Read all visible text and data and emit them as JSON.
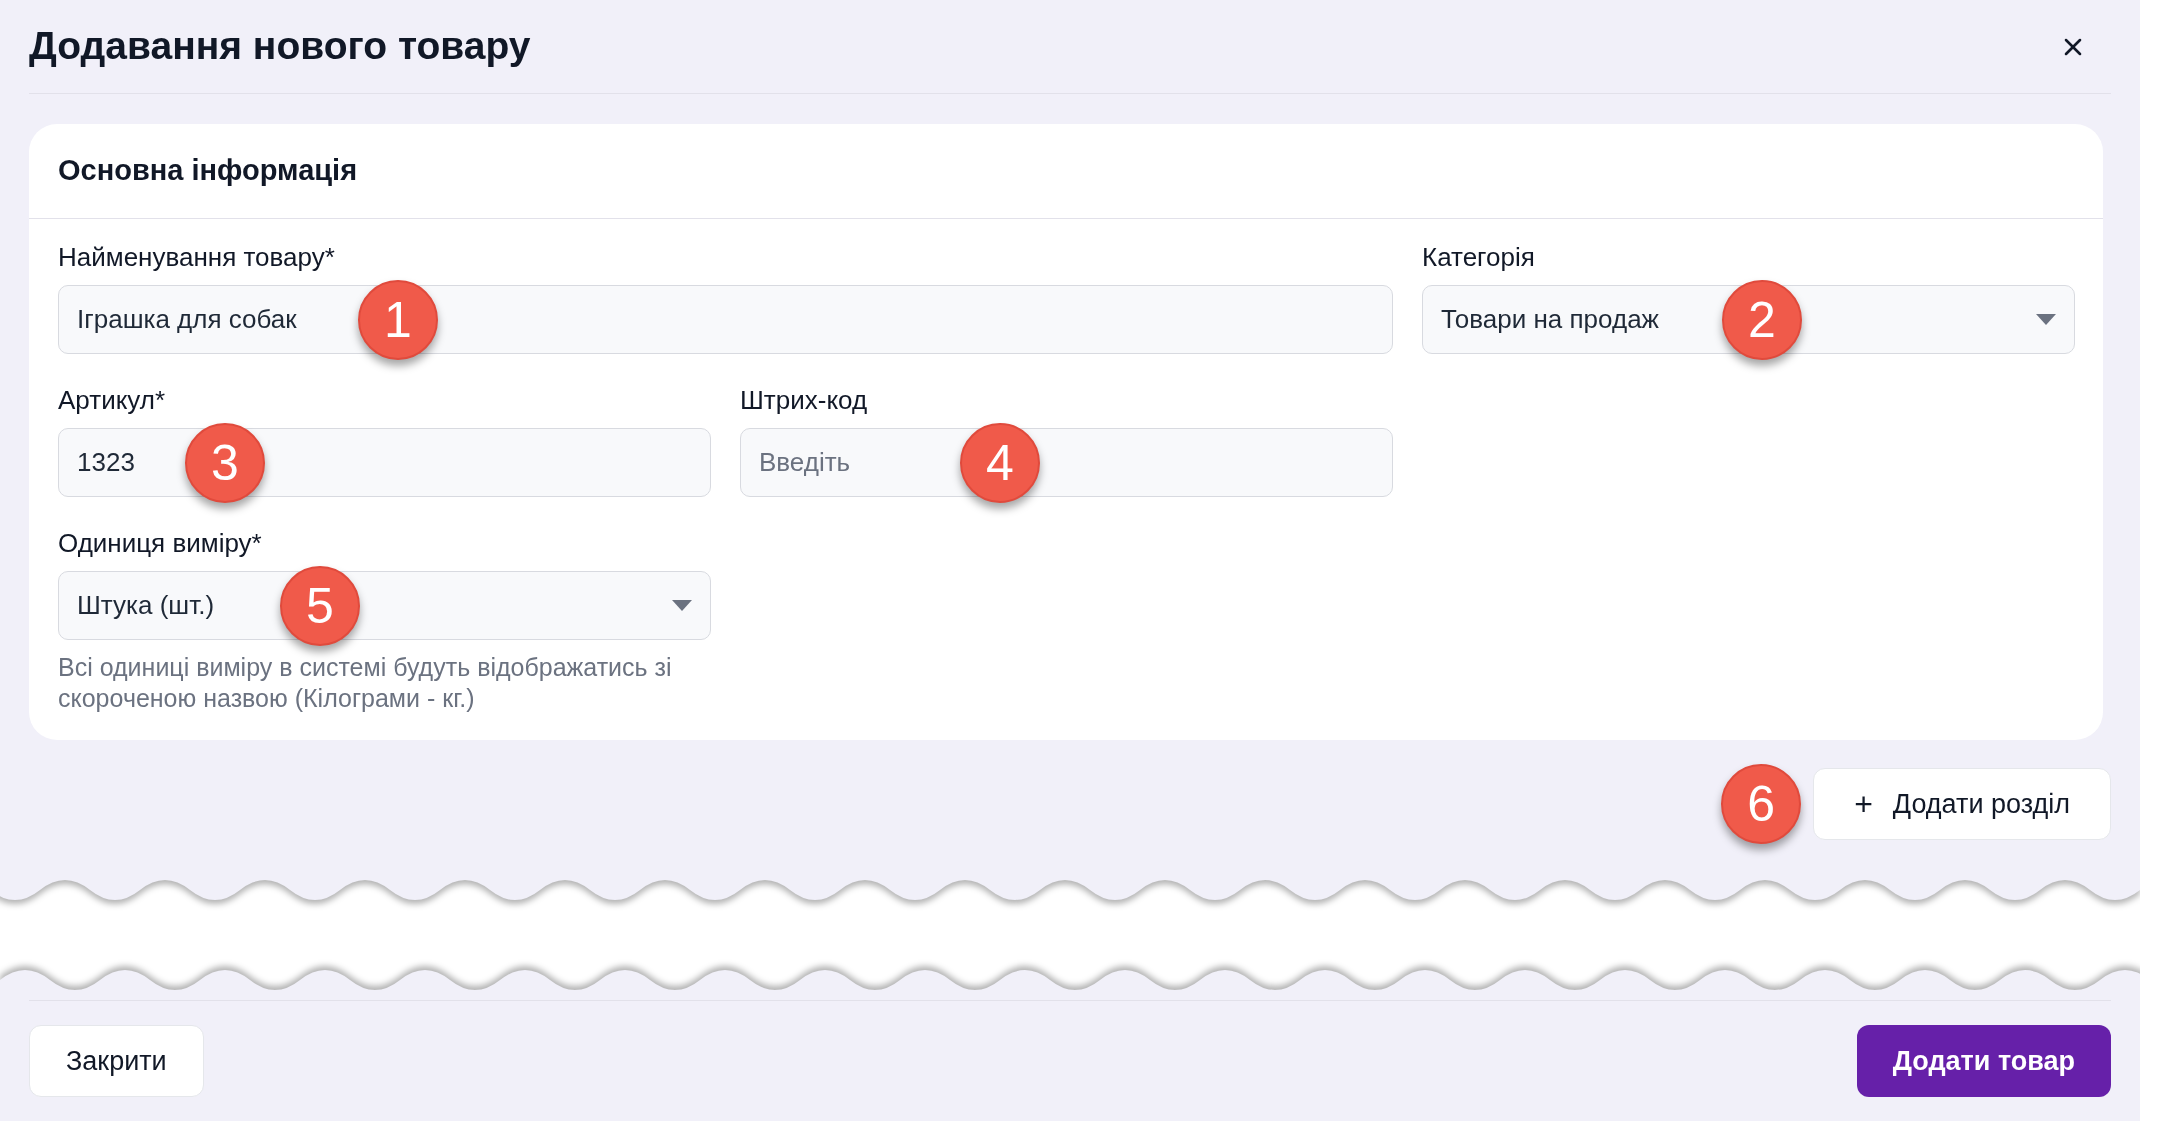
{
  "dialog": {
    "title": "Додавання нового товару"
  },
  "section": {
    "title": "Основна інформація",
    "fields": [
      {
        "kind": "input",
        "label": "Найменування товару*",
        "value": "Іграшка для собак",
        "marker": "1"
      },
      {
        "kind": "select",
        "label": "Категорія",
        "value": "Товари на продаж",
        "marker": "2"
      },
      {
        "kind": "input",
        "label": "Артикул*",
        "value": "1323",
        "marker": "3"
      },
      {
        "kind": "input",
        "label": "Штрих-код",
        "placeholder": "Введіть",
        "marker": "4"
      },
      {
        "kind": "select",
        "label": "Одиниця виміру*",
        "value": "Штука (шт.)",
        "marker": "5",
        "hint": "Всі одиниці виміру в системі будуть відображатись зі скороченою назвою (Кілограми - кг.)"
      }
    ]
  },
  "add_section_button": {
    "label": "Додати розділ",
    "icon": "+",
    "marker": "6"
  },
  "footer": {
    "close_button": "Закрити",
    "submit_button": "Додати товар"
  }
}
